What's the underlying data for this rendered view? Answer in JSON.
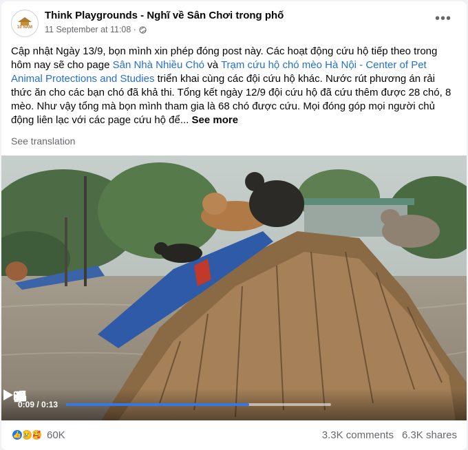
{
  "post": {
    "page_name": "Think Playgrounds - Nghĩ về Sân Chơi trong phố",
    "timestamp": "11 September at 11:08 ·",
    "avatar_text": "10 NĂM",
    "more_icon": "more-horizontal-icon",
    "body": {
      "part1": "Cập nhật Ngày 13/9, bọn mình xin phép đóng post này. Các hoạt động cứu hộ tiếp theo trong hôm nay sẽ cho page ",
      "link1": "Sân Nhà Nhiều Chó",
      "part2": " và ",
      "link2": "Trạm cứu hộ chó mèo Hà Nội - Center of Pet Animal Protections and Studies",
      "part3": " triển khai cùng các đội cứu hộ khác. Nước rút phương án rải thức ăn cho các bạn chó đã khả thi. Tổng kết ngày 12/9 đội cứu hộ đã cứu thêm được 28 chó, 8 mèo. Như vậy tổng mà bọn mình tham gia là 68 chó được cứu. Mọi đóng góp mọi người chủ động liên lạc với các page cứu hộ để... ",
      "see_more": "See more"
    },
    "see_translation": "See translation"
  },
  "video": {
    "time": "0:09 / 0:13",
    "progress_fraction": 0.69,
    "accent": "#3578e5"
  },
  "footer": {
    "reaction_count": "60K",
    "comments": "3.3K comments",
    "shares": "6.3K shares"
  }
}
